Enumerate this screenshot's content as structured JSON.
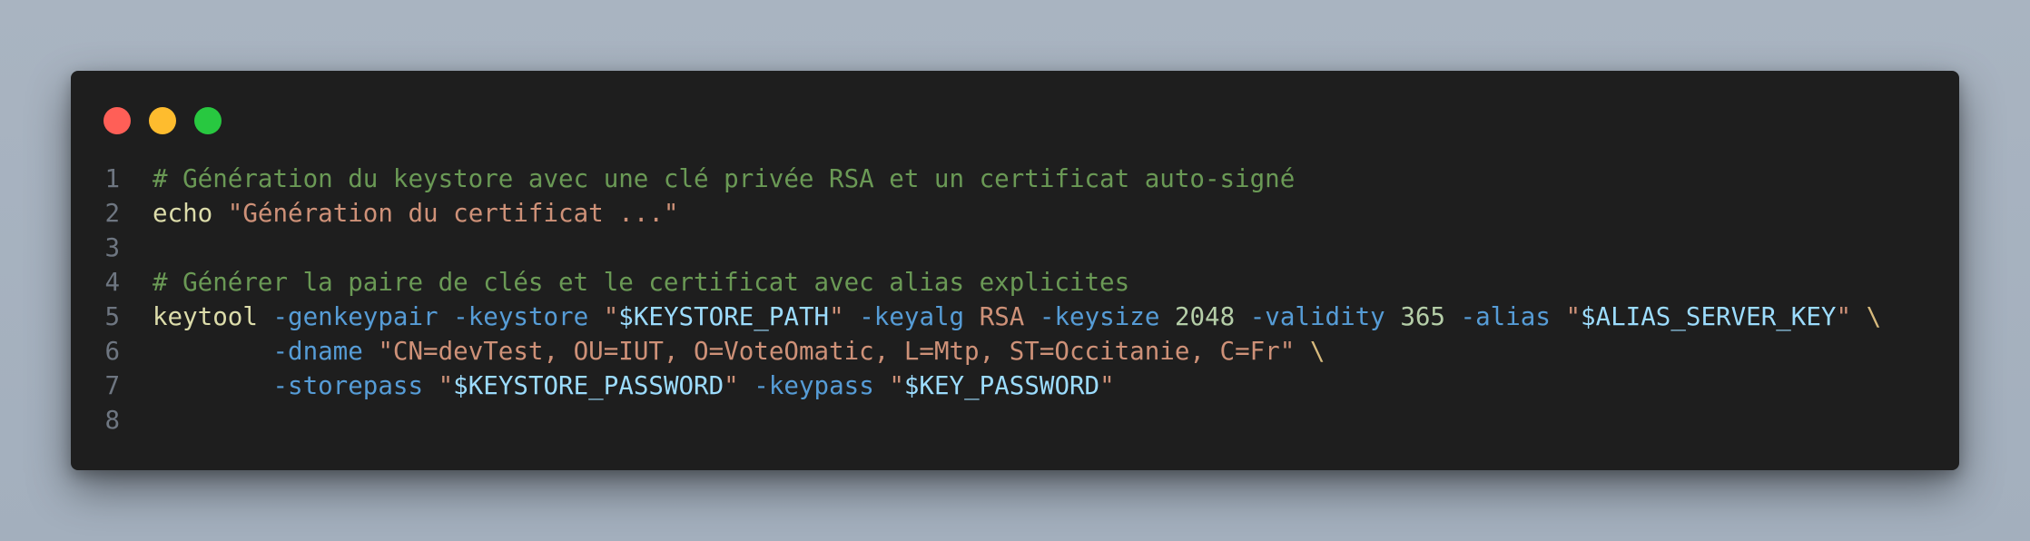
{
  "window": {
    "controls": {
      "close_color": "#ff5f57",
      "minimize_color": "#febc2e",
      "maximize_color": "#28c840"
    }
  },
  "editor": {
    "lines": [
      {
        "number": "1",
        "tokens": [
          {
            "type": "comment",
            "text": "# Génération du keystore avec une clé privée RSA et un certificat auto-signé"
          }
        ]
      },
      {
        "number": "2",
        "tokens": [
          {
            "type": "cmd",
            "text": "echo"
          },
          {
            "type": "plain",
            "text": " "
          },
          {
            "type": "str",
            "text": "\"Génération du certificat ...\""
          }
        ]
      },
      {
        "number": "3",
        "tokens": []
      },
      {
        "number": "4",
        "tokens": [
          {
            "type": "comment",
            "text": "# Générer la paire de clés et le certificat avec alias explicites"
          }
        ]
      },
      {
        "number": "5",
        "tokens": [
          {
            "type": "cmd",
            "text": "keytool"
          },
          {
            "type": "plain",
            "text": " "
          },
          {
            "type": "flag",
            "text": "-genkeypair"
          },
          {
            "type": "plain",
            "text": " "
          },
          {
            "type": "flag",
            "text": "-keystore"
          },
          {
            "type": "plain",
            "text": " "
          },
          {
            "type": "str",
            "text": "\""
          },
          {
            "type": "var",
            "text": "$KEYSTORE_PATH"
          },
          {
            "type": "str",
            "text": "\""
          },
          {
            "type": "plain",
            "text": " "
          },
          {
            "type": "flag",
            "text": "-keyalg"
          },
          {
            "type": "plain",
            "text": " "
          },
          {
            "type": "str",
            "text": "RSA"
          },
          {
            "type": "plain",
            "text": " "
          },
          {
            "type": "flag",
            "text": "-keysize"
          },
          {
            "type": "plain",
            "text": " "
          },
          {
            "type": "num",
            "text": "2048"
          },
          {
            "type": "plain",
            "text": " "
          },
          {
            "type": "flag",
            "text": "-validity"
          },
          {
            "type": "plain",
            "text": " "
          },
          {
            "type": "num",
            "text": "365"
          },
          {
            "type": "plain",
            "text": " "
          },
          {
            "type": "flag",
            "text": "-alias"
          },
          {
            "type": "plain",
            "text": " "
          },
          {
            "type": "str",
            "text": "\""
          },
          {
            "type": "var",
            "text": "$ALIAS_SERVER_KEY"
          },
          {
            "type": "str",
            "text": "\""
          },
          {
            "type": "plain",
            "text": " "
          },
          {
            "type": "cont",
            "text": "\\"
          }
        ]
      },
      {
        "number": "6",
        "tokens": [
          {
            "type": "plain",
            "text": "        "
          },
          {
            "type": "flag",
            "text": "-dname"
          },
          {
            "type": "plain",
            "text": " "
          },
          {
            "type": "str",
            "text": "\"CN=devTest, OU=IUT, O=VoteOmatic, L=Mtp, ST=Occitanie, C=Fr\""
          },
          {
            "type": "plain",
            "text": " "
          },
          {
            "type": "cont",
            "text": "\\"
          }
        ]
      },
      {
        "number": "7",
        "tokens": [
          {
            "type": "plain",
            "text": "        "
          },
          {
            "type": "flag",
            "text": "-storepass"
          },
          {
            "type": "plain",
            "text": " "
          },
          {
            "type": "str",
            "text": "\""
          },
          {
            "type": "var",
            "text": "$KEYSTORE_PASSWORD"
          },
          {
            "type": "str",
            "text": "\""
          },
          {
            "type": "plain",
            "text": " "
          },
          {
            "type": "flag",
            "text": "-keypass"
          },
          {
            "type": "plain",
            "text": " "
          },
          {
            "type": "str",
            "text": "\""
          },
          {
            "type": "var",
            "text": "$KEY_PASSWORD"
          },
          {
            "type": "str",
            "text": "\""
          }
        ]
      },
      {
        "number": "8",
        "tokens": []
      }
    ]
  }
}
